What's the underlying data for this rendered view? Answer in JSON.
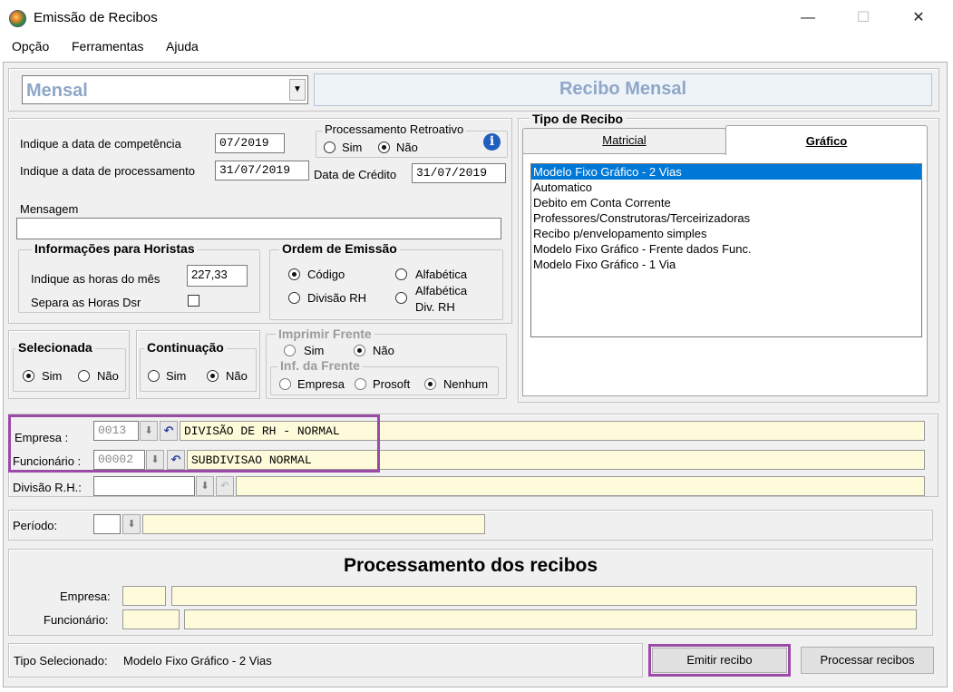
{
  "window": {
    "title": "Emissão de Recibos",
    "minimize_glyph": "—",
    "maximize_glyph": "☐",
    "close_glyph": "✕"
  },
  "menu": [
    "Opção",
    "Ferramentas",
    "Ajuda"
  ],
  "header": {
    "mode_select_value": "Mensal",
    "banner": "Recibo Mensal"
  },
  "dates": {
    "competencia_label": "Indique a data de competência",
    "competencia_value": "07/2019",
    "processamento_label": "Indique a data de processamento",
    "processamento_value": "31/07/2019",
    "credito_label": "Data de Crédito",
    "credito_value": "31/07/2019"
  },
  "retroativo": {
    "title": "Processamento Retroativo",
    "sim": "Sim",
    "nao": "Não",
    "selected": "nao"
  },
  "mensagem": {
    "label": "Mensagem",
    "value": ""
  },
  "horistas": {
    "title": "Informações para Horistas",
    "horas_label": "Indique as horas do mês",
    "horas_value": "227,33",
    "dsr_label": "Separa as Horas Dsr",
    "dsr_checked": false
  },
  "ordem": {
    "title": "Ordem de Emissão",
    "codigo": "Código",
    "alfabetica": "Alfabética",
    "divisao": "Divisão RH",
    "alfabetica_div_1": "Alfabética",
    "alfabetica_div_2": "Div.  RH",
    "selected": "codigo"
  },
  "tipo_recibo": {
    "title": "Tipo de Recibo",
    "tabs": [
      "Matricial",
      "Gráfico"
    ],
    "active_tab": "Gráfico",
    "items": [
      "Modelo Fixo Gráfico - 2 Vias",
      "Automatico",
      "Debito em Conta Corrente",
      "Professores/Construtoras/Terceirizadoras",
      "Recibo p/envelopamento simples",
      "Modelo Fixo Gráfico - Frente dados Func.",
      "Modelo Fixo Gráfico - 1 Via"
    ],
    "selected_index": 0
  },
  "selecionada": {
    "title": "Selecionada",
    "sim": "Sim",
    "nao": "Não",
    "selected": "sim"
  },
  "continuacao": {
    "title": "Continuação",
    "sim": "Sim",
    "nao": "Não",
    "selected": "nao"
  },
  "imprimir_frente": {
    "title": "Imprimir Frente",
    "sim": "Sim",
    "nao": "Não",
    "selected": "nao",
    "inf_title": "Inf. da Frente",
    "empresa": "Empresa",
    "prosoft": "Prosoft",
    "nenhum": "Nenhum",
    "inf_selected": "nenhum"
  },
  "filters": {
    "empresa_label": "Empresa :",
    "empresa_code": "0013",
    "empresa_name": "DIVISÃO DE RH - NORMAL",
    "funcionario_label": "Funcionário :",
    "funcionario_code": "00002",
    "funcionario_name": "SUBDIVISAO NORMAL",
    "divisao_label": "Divisão R.H.:",
    "divisao_code": "",
    "divisao_name": "",
    "periodo_label": "Período:",
    "periodo_code": "",
    "periodo_name": ""
  },
  "processamento": {
    "title": "Processamento dos recibos",
    "empresa_label": "Empresa:",
    "funcionario_label": "Funcionário:"
  },
  "status": {
    "label": "Tipo Selecionado:",
    "value": "Modelo Fixo Gráfico - 2 Vias"
  },
  "buttons": {
    "emitir": "Emitir recibo",
    "processar": "Processar recibos"
  },
  "colors": {
    "highlight": "#9b4aa8",
    "banner_text": "#8fa6c8",
    "field_yellow": "#fdfbd9",
    "list_selection": "#0078d7"
  }
}
